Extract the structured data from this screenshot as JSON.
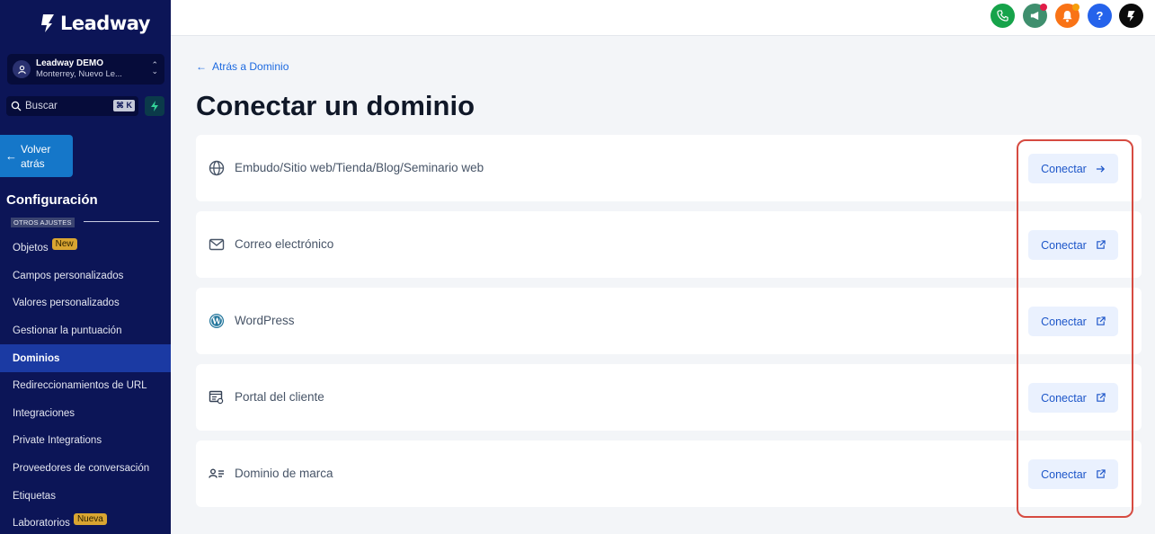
{
  "brand": {
    "name": "Leadway"
  },
  "account": {
    "name": "Leadway DEMO",
    "location": "Monterrey, Nuevo Le..."
  },
  "search": {
    "placeholder": "Buscar",
    "shortcut": "⌘ K"
  },
  "sidebar": {
    "back_label": "Volver atrás",
    "section_title": "Configuración",
    "subsection": "OTROS AJUSTES",
    "items": [
      {
        "label": "Objetos",
        "badge": "New"
      },
      {
        "label": "Campos personalizados"
      },
      {
        "label": "Valores personalizados"
      },
      {
        "label": "Gestionar la puntuación"
      },
      {
        "label": "Dominios",
        "active": true
      },
      {
        "label": "Redireccionamientos de URL"
      },
      {
        "label": "Integraciones"
      },
      {
        "label": "Private Integrations"
      },
      {
        "label": "Proveedores de conversación"
      },
      {
        "label": "Etiquetas"
      },
      {
        "label": "Laboratorios",
        "badge": "Nueva"
      }
    ]
  },
  "topbar": {
    "icons": [
      {
        "name": "phone-icon",
        "color": "#16a34a"
      },
      {
        "name": "megaphone-icon",
        "color": "#3f8f6e",
        "dot": "#e11d48"
      },
      {
        "name": "bell-icon",
        "color": "#f97316",
        "dot": "#f59e0b"
      },
      {
        "name": "help-icon",
        "color": "#2563eb",
        "text": "?"
      },
      {
        "name": "brand-icon",
        "color": "#0b0b0b"
      }
    ]
  },
  "main": {
    "breadcrumb": "Atrás a Dominio",
    "title": "Conectar un dominio",
    "button_label": "Conectar",
    "options": [
      {
        "label": "Embudo/Sitio web/Tienda/Blog/Seminario web",
        "icon": "globe-icon",
        "action": "arrow-right-icon"
      },
      {
        "label": "Correo electrónico",
        "icon": "mail-icon",
        "action": "external-link-icon"
      },
      {
        "label": "WordPress",
        "icon": "wordpress-icon",
        "action": "external-link-icon"
      },
      {
        "label": "Portal del cliente",
        "icon": "portal-icon",
        "action": "external-link-icon"
      },
      {
        "label": "Dominio de marca",
        "icon": "brand-domain-icon",
        "action": "external-link-icon"
      }
    ]
  },
  "colors": {
    "sidebar_bg": "#0c1557",
    "accent": "#1d6ae0",
    "highlight": "#d64b41"
  }
}
